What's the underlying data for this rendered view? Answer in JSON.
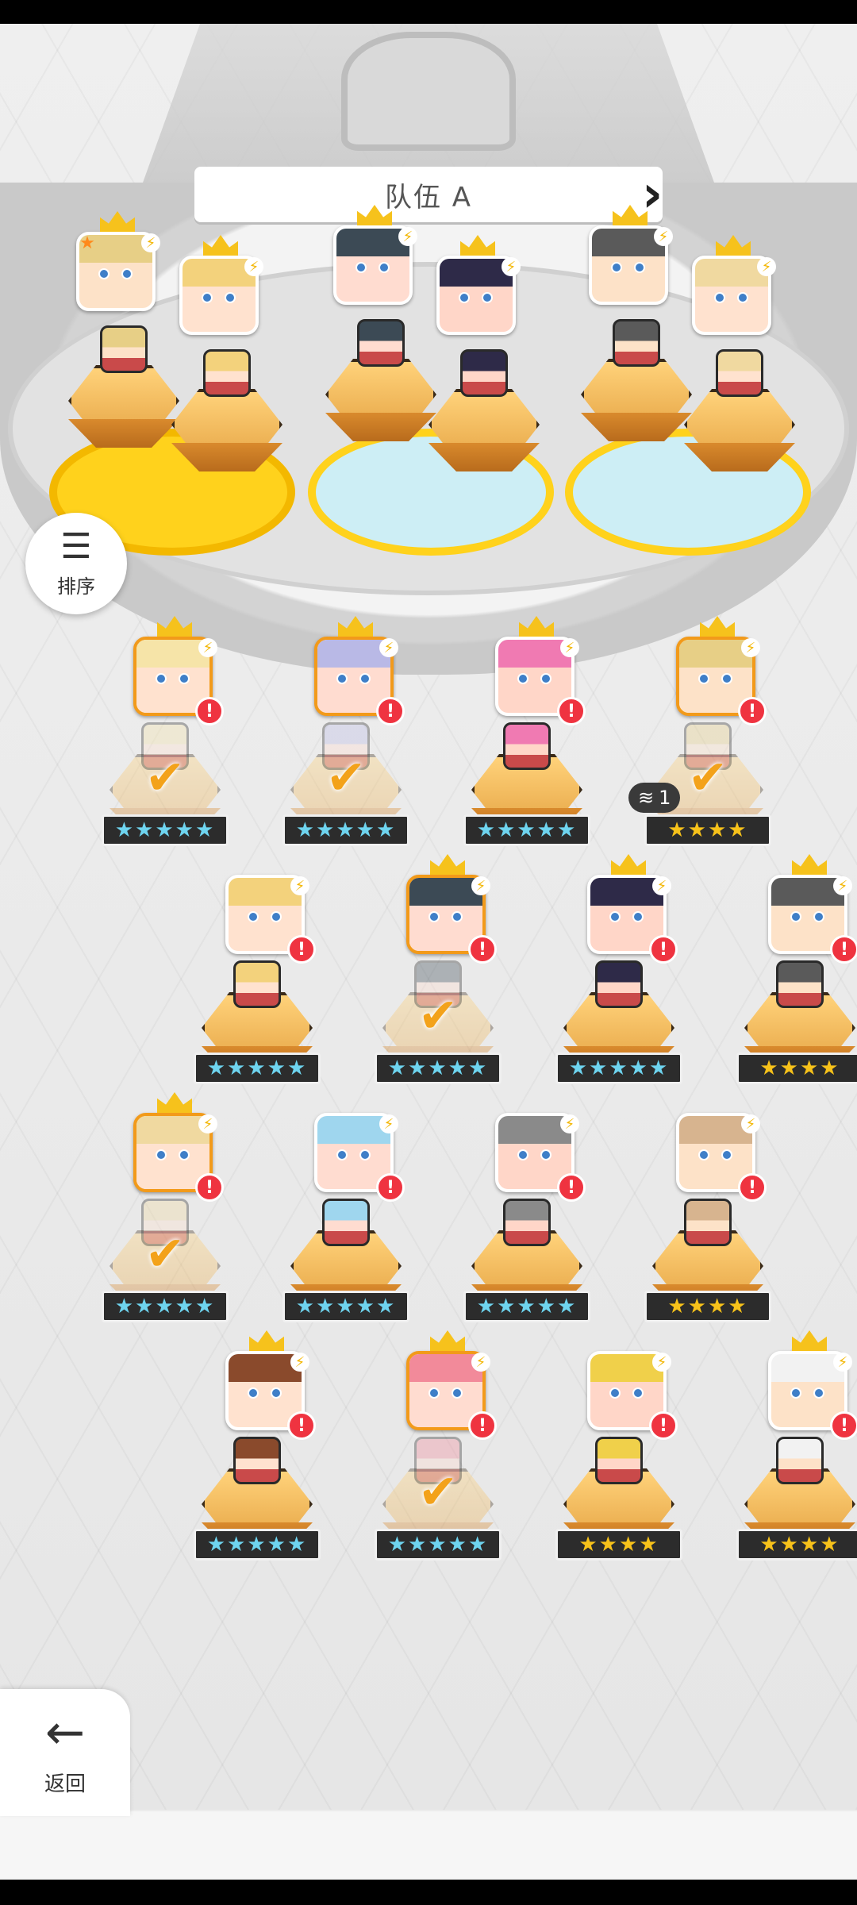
{
  "team": {
    "title": "队伍 A",
    "prev_icon": "chevron-left-icon",
    "next_icon": "chevron-right-icon"
  },
  "sort": {
    "label": "排序",
    "icon": "sort-icon"
  },
  "back": {
    "label": "返回",
    "icon": "arrow-left-icon"
  },
  "colors": {
    "accent": "#f29a1a",
    "alert": "#ef3340",
    "crown": "#f6c21c",
    "pad_yellow": "#ffd21c",
    "pad_blue": "#cdeef5"
  },
  "roster": [
    {
      "row": 1,
      "col": 1,
      "stars": "★★★★★",
      "star_color": "blue",
      "selected": true,
      "checked": true,
      "alert": "!",
      "crown": true,
      "bolt": "⚡"
    },
    {
      "row": 1,
      "col": 2,
      "stars": "★★★★★",
      "star_color": "blue",
      "selected": true,
      "checked": true,
      "alert": "!",
      "crown": true,
      "bolt": "⚡"
    },
    {
      "row": 1,
      "col": 3,
      "stars": "★★★★★",
      "star_color": "blue",
      "selected": false,
      "checked": false,
      "alert": "!",
      "crown": true,
      "bolt": "⚡"
    },
    {
      "row": 1,
      "col": 4,
      "stars": "★★★★",
      "star_color": "gold",
      "selected": true,
      "checked": true,
      "alert": "!",
      "crown": true,
      "bolt": "⚡",
      "level": "1"
    },
    {
      "row": 2,
      "col": 1,
      "stars": "★★★★★",
      "star_color": "blue",
      "selected": false,
      "checked": false,
      "alert": "!",
      "crown": false,
      "bolt": "⚡"
    },
    {
      "row": 2,
      "col": 2,
      "stars": "★★★★★",
      "star_color": "blue",
      "selected": true,
      "checked": true,
      "alert": "!",
      "crown": true,
      "bolt": "⚡"
    },
    {
      "row": 2,
      "col": 3,
      "stars": "★★★★★",
      "star_color": "blue",
      "selected": false,
      "checked": false,
      "alert": "!",
      "crown": true,
      "bolt": "⚡"
    },
    {
      "row": 2,
      "col": 4,
      "stars": "★★★★",
      "star_color": "gold",
      "selected": false,
      "checked": false,
      "alert": "!",
      "crown": true,
      "bolt": "⚡"
    },
    {
      "row": 3,
      "col": 1,
      "stars": "★★★★★",
      "star_color": "blue",
      "selected": true,
      "checked": true,
      "alert": "!",
      "crown": true,
      "bolt": "⚡"
    },
    {
      "row": 3,
      "col": 2,
      "stars": "★★★★★",
      "star_color": "blue",
      "selected": false,
      "checked": false,
      "alert": "!",
      "crown": false,
      "bolt": "⚡"
    },
    {
      "row": 3,
      "col": 3,
      "stars": "★★★★★",
      "star_color": "blue",
      "selected": false,
      "checked": false,
      "alert": "!",
      "crown": false,
      "bolt": "⚡"
    },
    {
      "row": 3,
      "col": 4,
      "stars": "★★★★",
      "star_color": "gold",
      "selected": false,
      "checked": false,
      "alert": "!",
      "crown": false,
      "bolt": "⚡"
    },
    {
      "row": 4,
      "col": 1,
      "stars": "★★★★★",
      "star_color": "blue",
      "selected": false,
      "checked": false,
      "alert": "!",
      "crown": true,
      "bolt": "⚡"
    },
    {
      "row": 4,
      "col": 2,
      "stars": "★★★★★",
      "star_color": "blue",
      "selected": true,
      "checked": true,
      "alert": "!",
      "crown": true,
      "bolt": "⚡"
    },
    {
      "row": 4,
      "col": 3,
      "stars": "★★★★",
      "star_color": "gold",
      "selected": false,
      "checked": false,
      "alert": "!",
      "crown": false,
      "bolt": "⚡"
    },
    {
      "row": 4,
      "col": 4,
      "stars": "★★★★",
      "star_color": "gold",
      "selected": false,
      "checked": false,
      "alert": "!",
      "crown": true,
      "bolt": "⚡"
    }
  ],
  "team_slots": [
    {
      "crown": true,
      "bolt": "⚡",
      "rank": "★"
    },
    {
      "crown": true,
      "bolt": "⚡"
    },
    {
      "crown": true,
      "bolt": "⚡"
    },
    {
      "crown": true,
      "bolt": "⚡"
    },
    {
      "crown": true,
      "bolt": "⚡"
    },
    {
      "crown": true,
      "bolt": "⚡"
    }
  ],
  "check_glyph": "✔"
}
